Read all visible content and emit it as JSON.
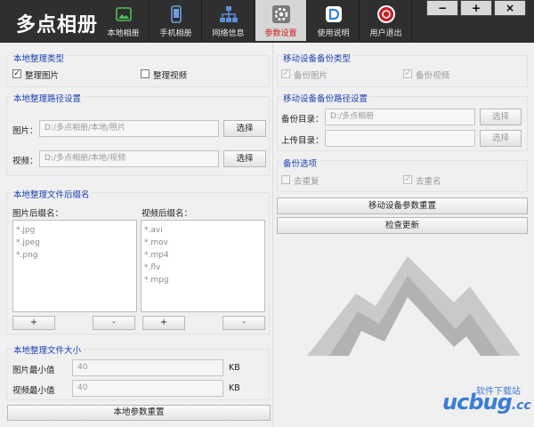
{
  "app": {
    "title": "多点相册"
  },
  "tabs": [
    {
      "label": "本地相册",
      "icon": "image-icon"
    },
    {
      "label": "手机相册",
      "icon": "phone-icon"
    },
    {
      "label": "网络信息",
      "icon": "network-icon"
    },
    {
      "label": "参数设置",
      "icon": "gear-icon",
      "active": true
    },
    {
      "label": "使用说明",
      "icon": "help-doc-icon"
    },
    {
      "label": "用户退出",
      "icon": "exit-icon"
    }
  ],
  "window_controls": {
    "minimize": "−",
    "maximize": "+",
    "close": "×"
  },
  "local": {
    "type_title": "本地整理类型",
    "organize_photos": {
      "label": "整理图片",
      "checked": true
    },
    "organize_videos": {
      "label": "整理视频",
      "checked": false
    },
    "path_title": "本地整理路径设置",
    "photo_label": "图片：",
    "photo_path": "D:/多点相册/本地/照片",
    "video_label": "视频：",
    "video_path": "D:/多点相册/本地/视频",
    "choose": "选择",
    "suffix_title": "本地整理文件后缀名",
    "photo_suffix_label": "图片后缀名：",
    "video_suffix_label": "视频后缀名：",
    "photo_suffixes": [
      "*.jpg",
      "*.jpeg",
      "*.png"
    ],
    "video_suffixes": [
      "*.avi",
      "*.mov",
      "*.mp4",
      "*.flv",
      "*.mpg"
    ],
    "add": "+",
    "remove": "-",
    "size_title": "本地整理文件大小",
    "photo_min_label": "图片最小值",
    "photo_min_value": "40",
    "video_min_label": "视频最小值",
    "video_min_value": "40",
    "unit": "KB",
    "reset": "本地参数重置"
  },
  "mobile": {
    "type_title": "移动设备备份类型",
    "backup_photos": {
      "label": "备份图片",
      "checked": true
    },
    "backup_videos": {
      "label": "备份视频",
      "checked": true
    },
    "path_title": "移动设备备份路径设置",
    "backup_dir_label": "备份目录：",
    "backup_dir_value": "D:/多点相册",
    "upload_dir_label": "上传目录：",
    "upload_dir_value": "",
    "choose": "选择",
    "options_title": "备份选项",
    "dedupe": {
      "label": "去重复",
      "checked": false
    },
    "dedupe_name": {
      "label": "去重名",
      "checked": true
    },
    "reset": "移动设备参数重置",
    "check_update": "检查更新"
  },
  "watermark": {
    "site": "软件下载站",
    "brand": "ucbug",
    "tld": ".cc"
  },
  "colors": {
    "section_title": "#1a3fb4",
    "active_tab_text": "#d21a1a",
    "topbar": "#2f2f2f",
    "watermark": "#3b7dd8"
  }
}
